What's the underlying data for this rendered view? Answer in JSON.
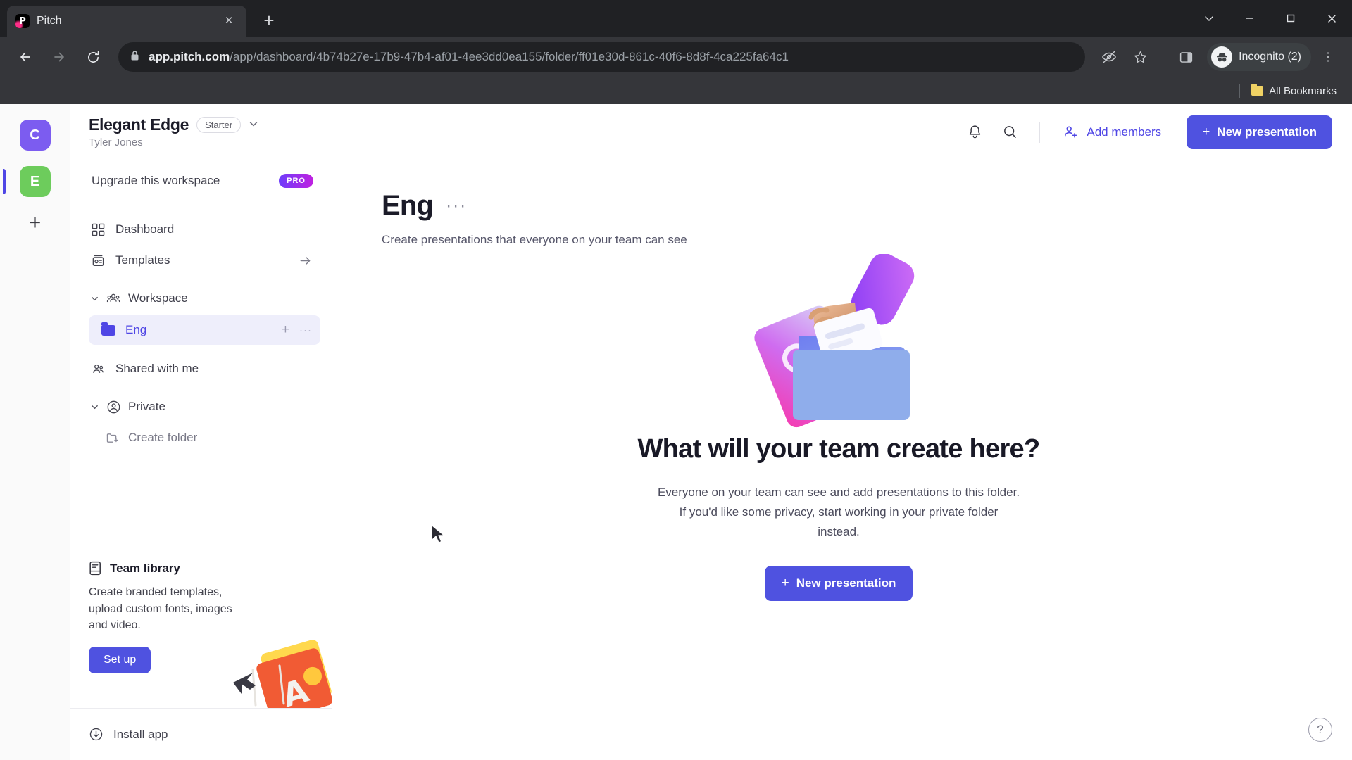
{
  "browser": {
    "tab": {
      "title": "Pitch",
      "favicon": "pitch-logo-icon",
      "close": "×"
    },
    "new_tab_label": "+",
    "window_controls": {
      "minimize": "−",
      "maximize": "□",
      "close": "×",
      "more": "⌄"
    },
    "nav": {
      "back": "←",
      "forward": "→",
      "reload": "↻"
    },
    "omnibox": {
      "lock_icon": "lock-icon",
      "host": "app.pitch.com",
      "path": "/app/dashboard/4b74b27e-17b9-47b4-af01-4ee3dd0ea155/folder/ff01e30d-861c-40f6-8d8f-4ca225fa64c1"
    },
    "toolbar_icons": {
      "incognito_eye": "eye-off-icon",
      "bookmark_star": "star-icon",
      "side_panel": "side-panel-icon",
      "menu": "⋮"
    },
    "profile": {
      "label": "Incognito (2)",
      "icon": "incognito-icon"
    },
    "bookmarks": {
      "all_bookmarks": "All Bookmarks",
      "folder_icon": "folder-icon"
    }
  },
  "rail": {
    "avatars": [
      {
        "letter": "C",
        "color": "#7c5cf0",
        "active": false
      },
      {
        "letter": "E",
        "color": "#6dcc5c",
        "active": true
      }
    ],
    "add_label": "+"
  },
  "sidebar": {
    "workspace": {
      "name": "Elegant Edge",
      "plan": "Starter",
      "owner": "Tyler Jones",
      "chevron": "⌄"
    },
    "upgrade": {
      "label": "Upgrade this workspace",
      "badge": "PRO"
    },
    "nav": [
      {
        "label": "Dashboard",
        "icon": "grid-icon"
      },
      {
        "label": "Templates",
        "icon": "templates-icon",
        "trailing": "→"
      }
    ],
    "groups": [
      {
        "label": "Workspace",
        "icon": "people-icon",
        "caret": "⌄",
        "folders": [
          {
            "label": "Eng",
            "selected": true,
            "add": "+",
            "more": "···"
          }
        ]
      }
    ],
    "shared": {
      "label": "Shared with me",
      "icon": "people-icon"
    },
    "private": {
      "label": "Private",
      "icon": "person-circle-icon",
      "caret": "⌄",
      "create_folder": {
        "label": "Create folder",
        "icon": "folder-plus-icon"
      }
    },
    "team_library": {
      "title": "Team library",
      "icon": "library-icon",
      "description": "Create branded templates, upload custom fonts, images and video.",
      "button": "Set up"
    },
    "install": {
      "label": "Install app",
      "icon": "download-icon"
    }
  },
  "header": {
    "notifications_icon": "bell-icon",
    "search_icon": "search-icon",
    "add_members": {
      "label": "Add members",
      "icon": "add-person-icon"
    },
    "new_presentation": {
      "label": "New presentation",
      "plus": "+"
    }
  },
  "main": {
    "title": "Eng",
    "title_more": "···",
    "subtitle": "Create presentations that everyone on your team can see",
    "empty_state": {
      "illustration": "hand-placing-card-in-folder-illustration",
      "heading": "What will your team create here?",
      "description_line1": "Everyone on your team can see and add presentations to this folder.",
      "description_line2": "If you'd like some privacy, start working in your private folder",
      "description_line3": "instead.",
      "button": {
        "label": "New presentation",
        "plus": "+"
      }
    },
    "help": "?"
  },
  "colors": {
    "accent": "#4f52e0",
    "accent_text": "#4f46e5",
    "selected_bg": "#eeeefb"
  }
}
